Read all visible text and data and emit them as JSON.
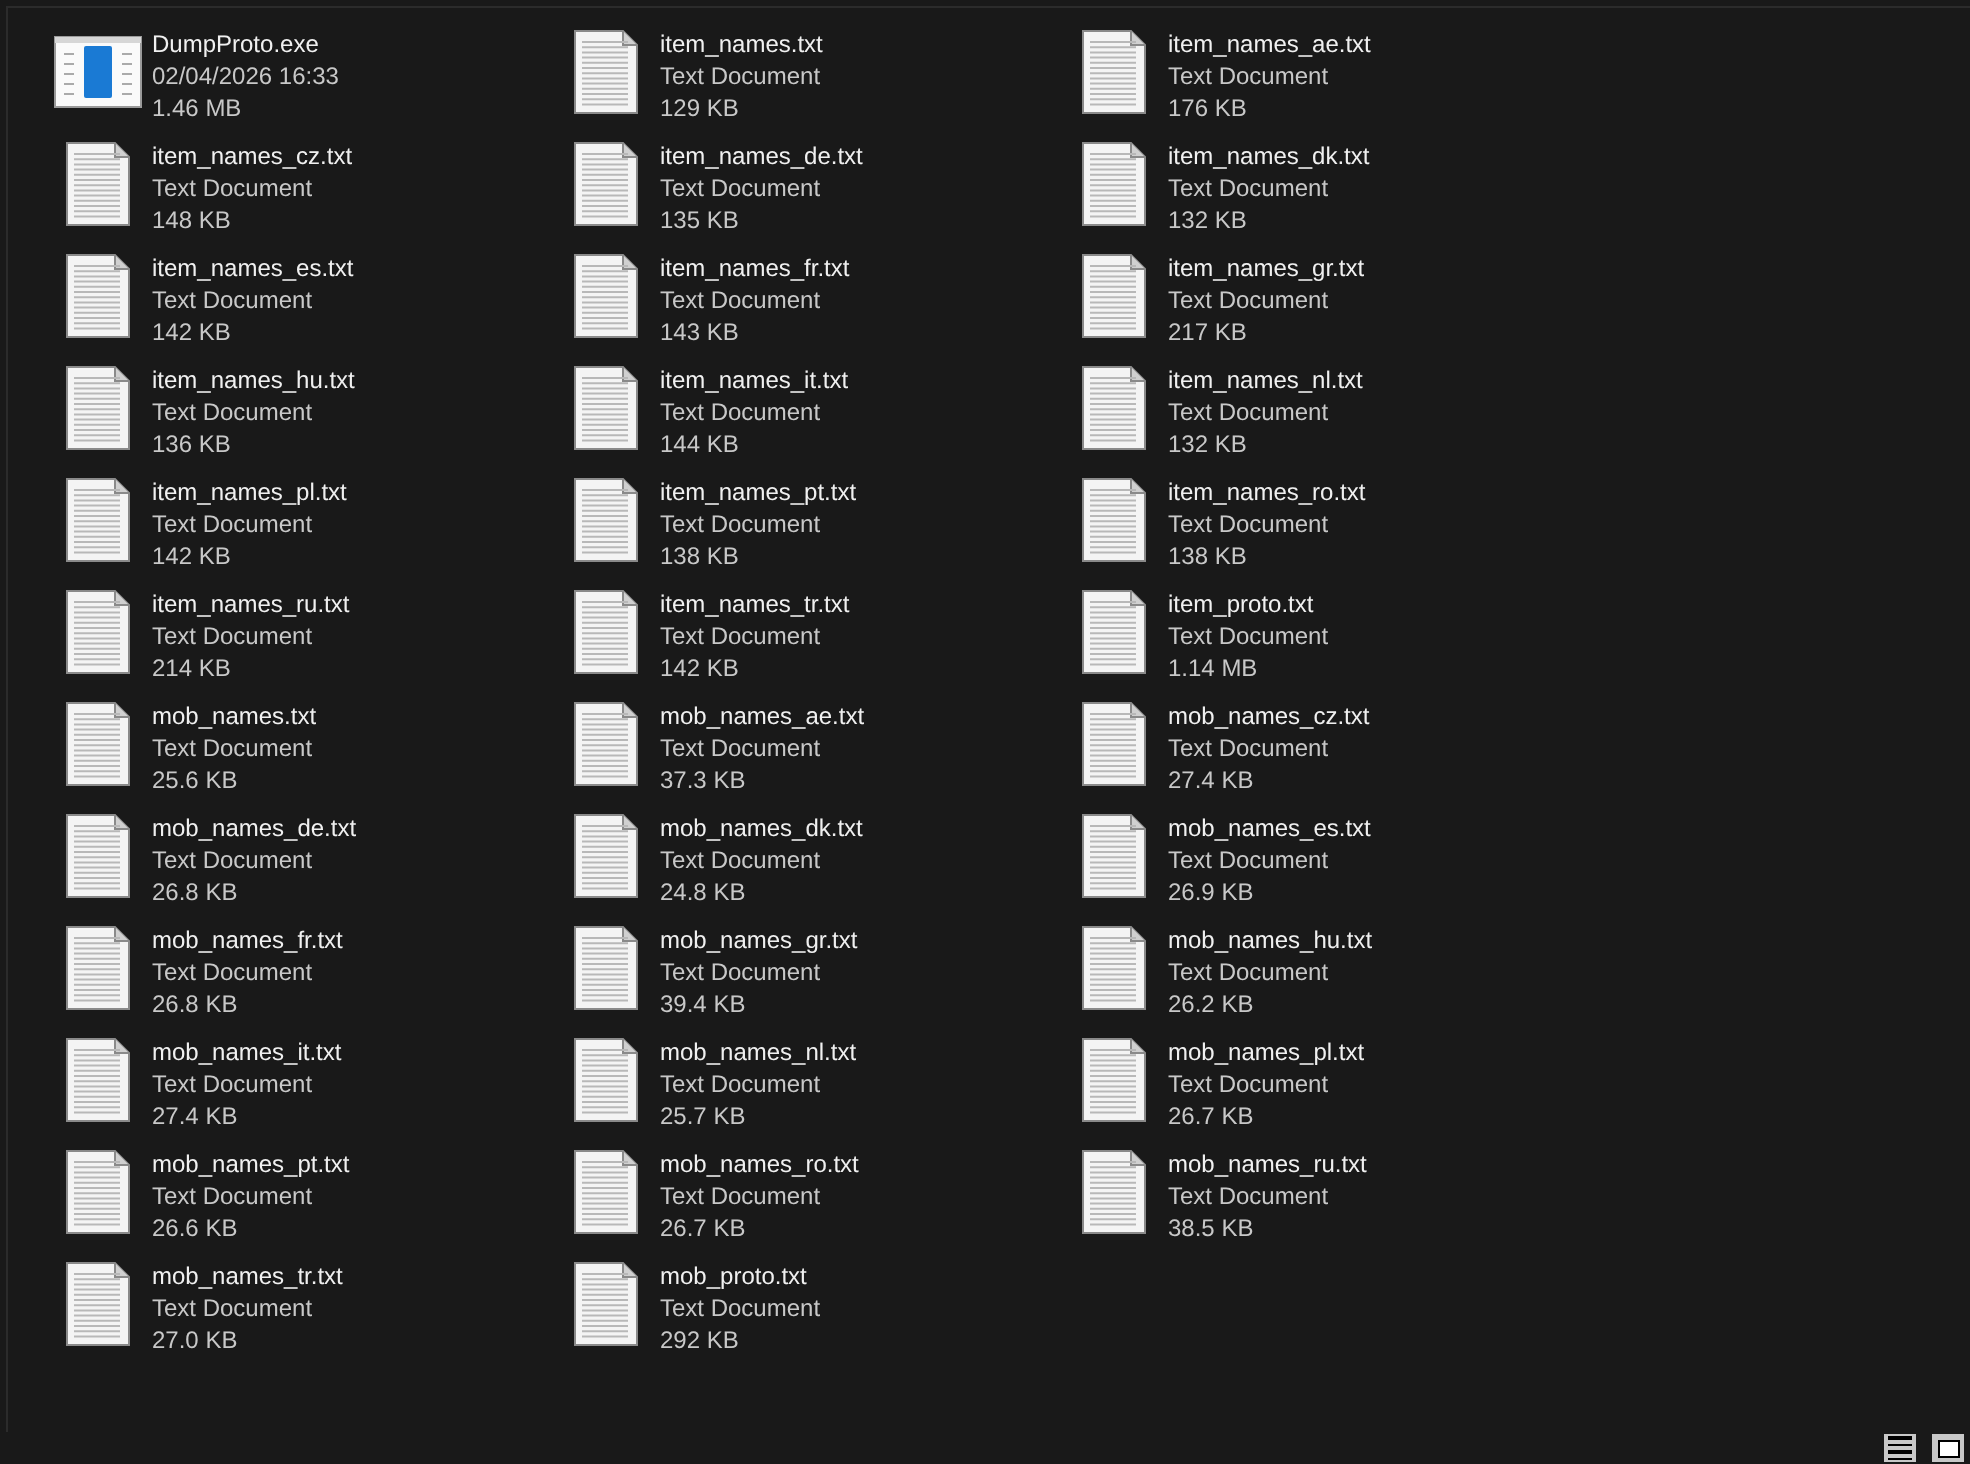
{
  "files": [
    {
      "kind": "exe",
      "name": "DumpProto.exe",
      "line_2": "02/04/2026 16:33",
      "line_3": "1.46 MB"
    },
    {
      "kind": "txt",
      "name": "item_names.txt",
      "line_2": "Text Document",
      "line_3": "129 KB"
    },
    {
      "kind": "txt",
      "name": "item_names_ae.txt",
      "line_2": "Text Document",
      "line_3": "176 KB"
    },
    {
      "kind": "txt",
      "name": "item_names_cz.txt",
      "line_2": "Text Document",
      "line_3": "148 KB"
    },
    {
      "kind": "txt",
      "name": "item_names_de.txt",
      "line_2": "Text Document",
      "line_3": "135 KB"
    },
    {
      "kind": "txt",
      "name": "item_names_dk.txt",
      "line_2": "Text Document",
      "line_3": "132 KB"
    },
    {
      "kind": "txt",
      "name": "item_names_es.txt",
      "line_2": "Text Document",
      "line_3": "142 KB"
    },
    {
      "kind": "txt",
      "name": "item_names_fr.txt",
      "line_2": "Text Document",
      "line_3": "143 KB"
    },
    {
      "kind": "txt",
      "name": "item_names_gr.txt",
      "line_2": "Text Document",
      "line_3": "217 KB"
    },
    {
      "kind": "txt",
      "name": "item_names_hu.txt",
      "line_2": "Text Document",
      "line_3": "136 KB"
    },
    {
      "kind": "txt",
      "name": "item_names_it.txt",
      "line_2": "Text Document",
      "line_3": "144 KB"
    },
    {
      "kind": "txt",
      "name": "item_names_nl.txt",
      "line_2": "Text Document",
      "line_3": "132 KB"
    },
    {
      "kind": "txt",
      "name": "item_names_pl.txt",
      "line_2": "Text Document",
      "line_3": "142 KB"
    },
    {
      "kind": "txt",
      "name": "item_names_pt.txt",
      "line_2": "Text Document",
      "line_3": "138 KB"
    },
    {
      "kind": "txt",
      "name": "item_names_ro.txt",
      "line_2": "Text Document",
      "line_3": "138 KB"
    },
    {
      "kind": "txt",
      "name": "item_names_ru.txt",
      "line_2": "Text Document",
      "line_3": "214 KB"
    },
    {
      "kind": "txt",
      "name": "item_names_tr.txt",
      "line_2": "Text Document",
      "line_3": "142 KB"
    },
    {
      "kind": "txt",
      "name": "item_proto.txt",
      "line_2": "Text Document",
      "line_3": "1.14 MB"
    },
    {
      "kind": "txt",
      "name": "mob_names.txt",
      "line_2": "Text Document",
      "line_3": "25.6 KB"
    },
    {
      "kind": "txt",
      "name": "mob_names_ae.txt",
      "line_2": "Text Document",
      "line_3": "37.3 KB"
    },
    {
      "kind": "txt",
      "name": "mob_names_cz.txt",
      "line_2": "Text Document",
      "line_3": "27.4 KB"
    },
    {
      "kind": "txt",
      "name": "mob_names_de.txt",
      "line_2": "Text Document",
      "line_3": "26.8 KB"
    },
    {
      "kind": "txt",
      "name": "mob_names_dk.txt",
      "line_2": "Text Document",
      "line_3": "24.8 KB"
    },
    {
      "kind": "txt",
      "name": "mob_names_es.txt",
      "line_2": "Text Document",
      "line_3": "26.9 KB"
    },
    {
      "kind": "txt",
      "name": "mob_names_fr.txt",
      "line_2": "Text Document",
      "line_3": "26.8 KB"
    },
    {
      "kind": "txt",
      "name": "mob_names_gr.txt",
      "line_2": "Text Document",
      "line_3": "39.4 KB"
    },
    {
      "kind": "txt",
      "name": "mob_names_hu.txt",
      "line_2": "Text Document",
      "line_3": "26.2 KB"
    },
    {
      "kind": "txt",
      "name": "mob_names_it.txt",
      "line_2": "Text Document",
      "line_3": "27.4 KB"
    },
    {
      "kind": "txt",
      "name": "mob_names_nl.txt",
      "line_2": "Text Document",
      "line_3": "25.7 KB"
    },
    {
      "kind": "txt",
      "name": "mob_names_pl.txt",
      "line_2": "Text Document",
      "line_3": "26.7 KB"
    },
    {
      "kind": "txt",
      "name": "mob_names_pt.txt",
      "line_2": "Text Document",
      "line_3": "26.6 KB"
    },
    {
      "kind": "txt",
      "name": "mob_names_ro.txt",
      "line_2": "Text Document",
      "line_3": "26.7 KB"
    },
    {
      "kind": "txt",
      "name": "mob_names_ru.txt",
      "line_2": "Text Document",
      "line_3": "38.5 KB"
    },
    {
      "kind": "txt",
      "name": "mob_names_tr.txt",
      "line_2": "Text Document",
      "line_3": "27.0 KB"
    },
    {
      "kind": "txt",
      "name": "mob_proto.txt",
      "line_2": "Text Document",
      "line_3": "292 KB"
    }
  ]
}
